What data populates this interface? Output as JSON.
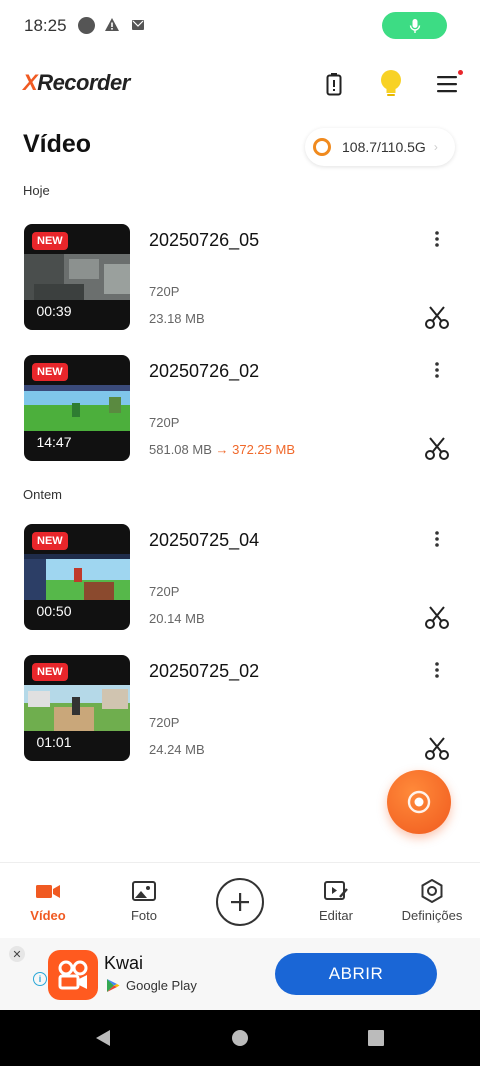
{
  "status": {
    "time": "18:25"
  },
  "app": {
    "logo_prefix": "X",
    "logo_rest": "Recorder"
  },
  "page": {
    "title": "Vídeo"
  },
  "storage": {
    "text": "108.7/110.5G"
  },
  "sections": [
    {
      "label": "Hoje"
    },
    {
      "label": "Ontem"
    }
  ],
  "videos": [
    {
      "name": "20250726_05",
      "badge": "NEW",
      "duration": "00:39",
      "resolution": "720P",
      "size": "23.18 MB",
      "compressed_size": ""
    },
    {
      "name": "20250726_02",
      "badge": "NEW",
      "duration": "14:47",
      "resolution": "720P",
      "size": "581.08 MB",
      "compressed_size": "→ 372.25 MB"
    },
    {
      "name": "20250725_04",
      "badge": "NEW",
      "duration": "00:50",
      "resolution": "720P",
      "size": "20.14 MB",
      "compressed_size": ""
    },
    {
      "name": "20250725_02",
      "badge": "NEW",
      "duration": "01:01",
      "resolution": "720P",
      "size": "24.24 MB",
      "compressed_size": ""
    }
  ],
  "nav": {
    "video": "Vídeo",
    "photo": "Foto",
    "edit": "Editar",
    "settings": "Definições"
  },
  "ad": {
    "title": "Kwai",
    "store": "Google Play",
    "button": "ABRIR"
  },
  "colors": {
    "accent": "#f05a22",
    "mic_pill": "#3ddc84",
    "ad_button": "#1a66d6",
    "badge_new": "#e8262b"
  }
}
